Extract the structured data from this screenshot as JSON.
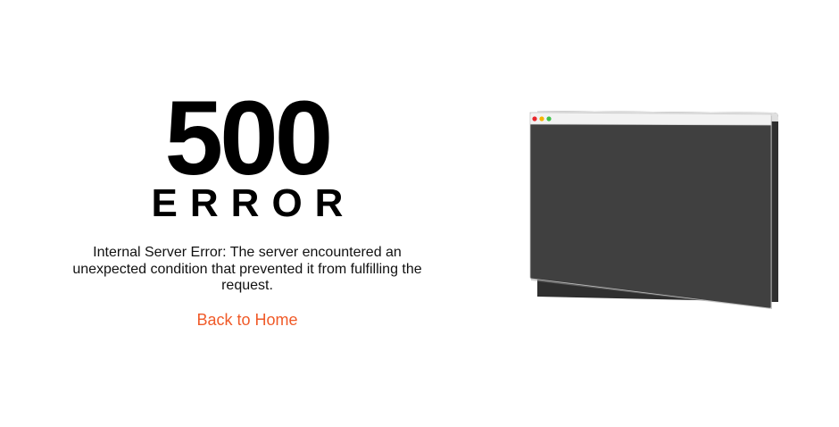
{
  "error": {
    "code": "500",
    "word": "ERROR",
    "message": "Internal Server Error: The server encountered an unexpected condition that prevented it from fulfilling the request.",
    "home_link": "Back to Home"
  },
  "colors": {
    "accent": "#f05a28",
    "window_body": "#404040",
    "window_bar": "#f2f2f2",
    "dot_red": "#e8262b",
    "dot_yellow": "#f5b400",
    "dot_green": "#3fc24a"
  },
  "illustration": {
    "icon": "browser-window-icon"
  }
}
